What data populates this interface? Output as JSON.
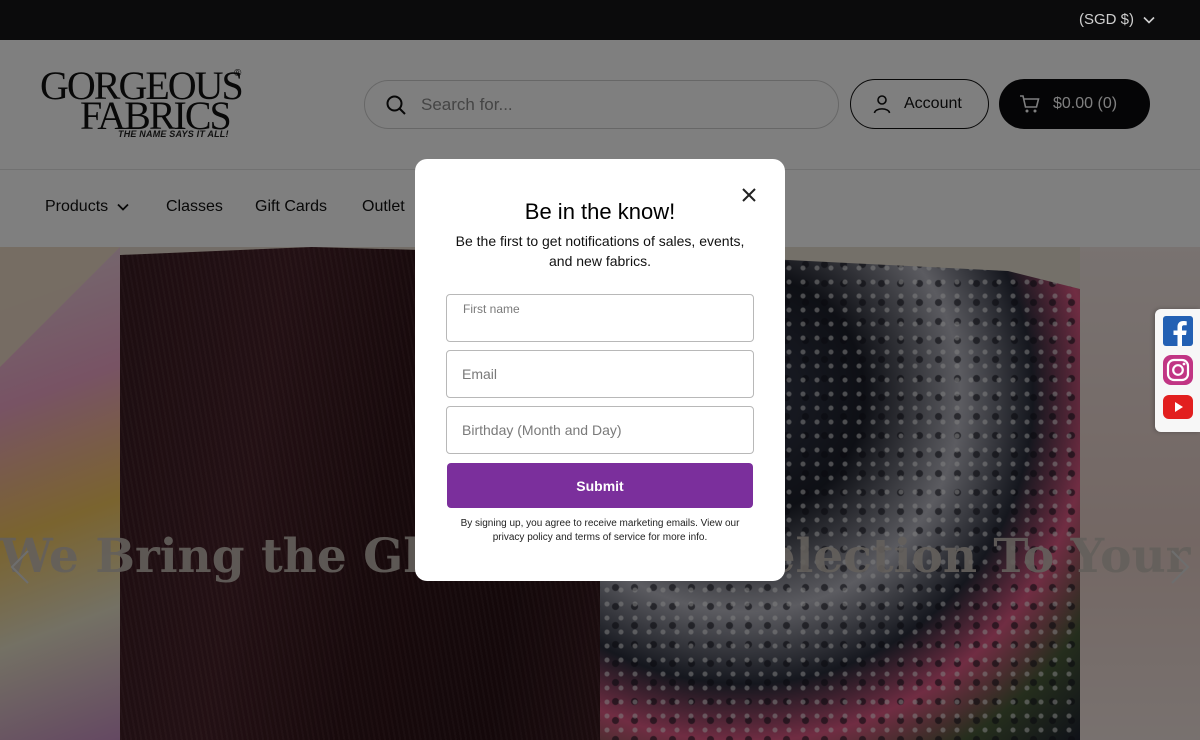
{
  "topbar": {
    "currency": "(SGD $)"
  },
  "logo": {
    "line1": "GORGEOUS",
    "line2": "FABRICS",
    "registered": "®",
    "tagline": "THE NAME SAYS IT ALL!"
  },
  "search": {
    "placeholder": "Search for..."
  },
  "header": {
    "account_label": "Account",
    "cart_label": "$0.00 (0)"
  },
  "nav": {
    "items": [
      "Products",
      "Classes",
      "Gift Cards",
      "Outlet"
    ]
  },
  "hero": {
    "title": "We Bring the Global Fabric Selection To Your Door!"
  },
  "modal": {
    "title": "Be in the know!",
    "subtitle": "Be the first to get notifications of sales, events, and new fabrics.",
    "first_name_label": "First name",
    "email_placeholder": "Email",
    "birthday_placeholder": "Birthday (Month and Day)",
    "submit_label": "Submit",
    "legal": "By signing up, you agree to receive marketing emails. View our privacy policy and terms of service for more info."
  },
  "social": {
    "icons": [
      "facebook-icon",
      "instagram-icon",
      "youtube-icon"
    ]
  },
  "colors": {
    "submit": "#7b2f9c",
    "topbar": "#0b0b0c",
    "cart": "#0b0b0c"
  }
}
